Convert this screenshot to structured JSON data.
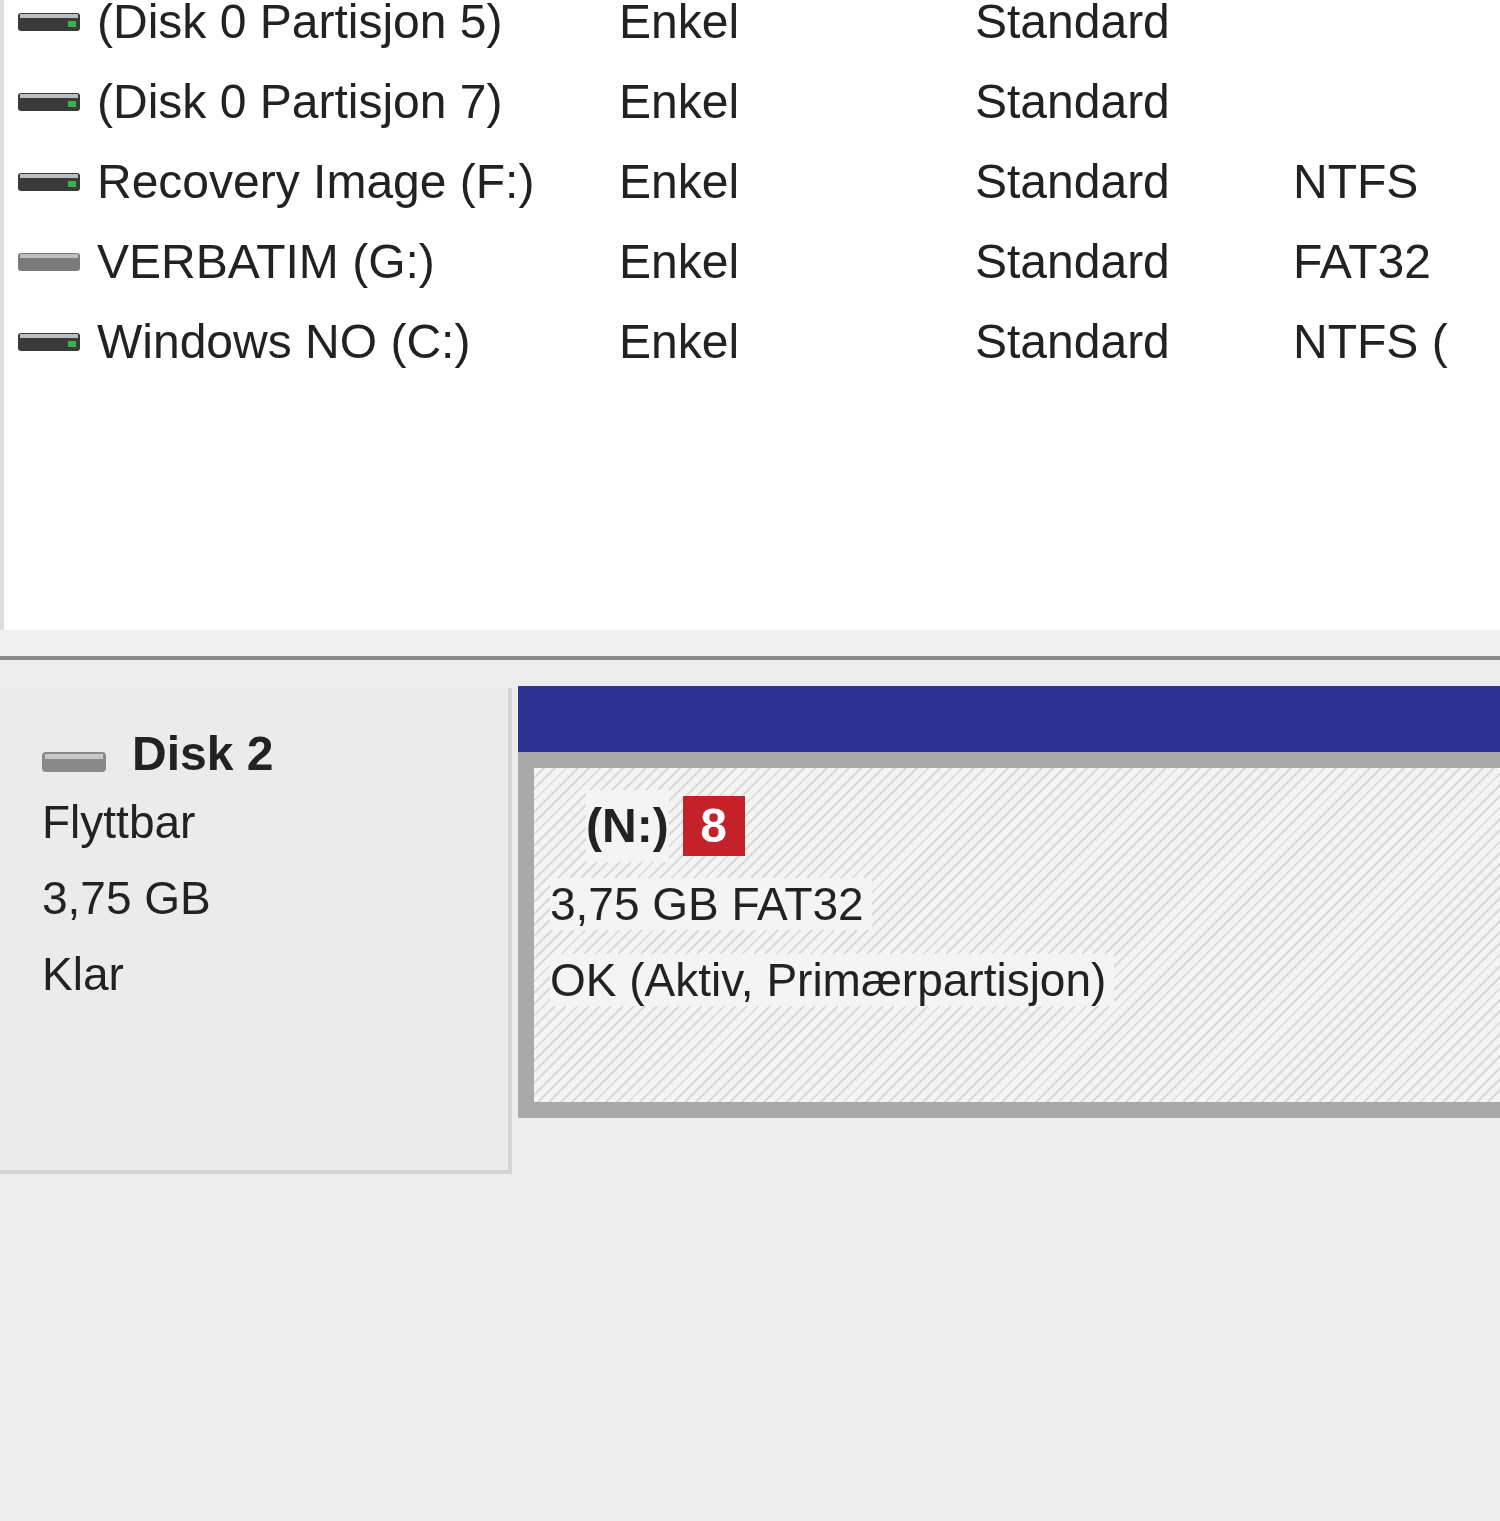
{
  "volumes": [
    {
      "name": "(Disk 0 Partisjon 5)",
      "layout": "Enkel",
      "type": "Standard",
      "kind": "fixed"
    },
    {
      "name": "(Disk 0 Partisjon 7)",
      "layout": "Enkel",
      "type": "Standard",
      "kind": "fixed"
    },
    {
      "name": "Recovery Image (F:)",
      "layout": "Enkel",
      "type": "Standard",
      "file_system": "NTFS",
      "kind": "fixed"
    },
    {
      "name": "VERBATIM (G:)",
      "layout": "Enkel",
      "type": "Standard",
      "file_system": "FAT32",
      "kind": "removable"
    },
    {
      "name": "Windows NO (C:)",
      "layout": "Enkel",
      "type": "Standard",
      "file_system": "NTFS (",
      "kind": "fixed"
    }
  ],
  "disk": {
    "name": "Disk 2",
    "type": "Flyttbar",
    "size": "3,75 GB",
    "status": "Klar"
  },
  "partition": {
    "label": "(N:)",
    "callout": "8",
    "size_fs": "3,75 GB FAT32",
    "status": "OK (Aktiv, Primærpartisjon)"
  }
}
